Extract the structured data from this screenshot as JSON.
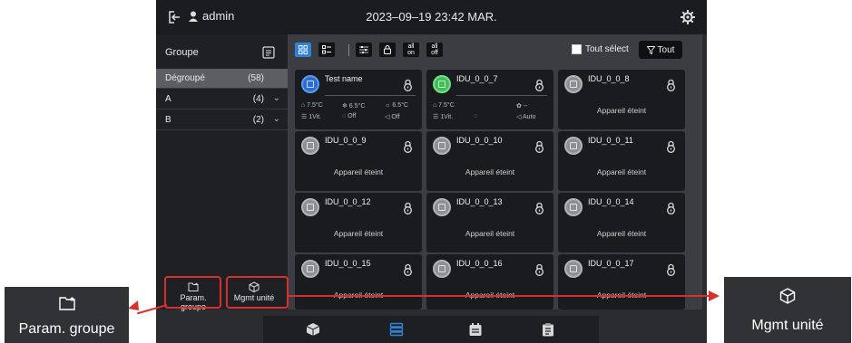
{
  "topbar": {
    "user": "admin",
    "datetime": "2023–09–19 23:42 MAR."
  },
  "sidebar": {
    "header": "Groupe",
    "groups": [
      {
        "name": "Dégroupé",
        "count": "(58)",
        "expandable": false,
        "selected": true
      },
      {
        "name": "A",
        "count": "(4)",
        "expandable": true,
        "selected": false
      },
      {
        "name": "B",
        "count": "(2)",
        "expandable": true,
        "selected": false
      }
    ],
    "param_groupe": "Param. groupe",
    "mgmt_unite": "Mgmt unité"
  },
  "toolbar": {
    "all_on": [
      "all",
      "on"
    ],
    "all_off": [
      "all",
      "off"
    ],
    "select_all": "Tout sélect",
    "filter_all": "Tout"
  },
  "cards": [
    {
      "name": "Test name",
      "color": "blue",
      "on": true,
      "row1": [
        "⌂ 7.5°C",
        "❄ 6.5°C",
        "☼ 6.5°C"
      ],
      "row2": [
        "☰ 1Vit.",
        "◌ Off",
        "◁ Off"
      ]
    },
    {
      "name": "IDU_0_0_7",
      "color": "green",
      "on": true,
      "row1": [
        "⌂ 7.5°C",
        "",
        "✿ --"
      ],
      "row2": [
        "☰ 1Vit.",
        "◌",
        "◁ Auto"
      ]
    },
    {
      "name": "IDU_0_0_8",
      "status": "Appareil éteint"
    },
    {
      "name": "IDU_0_0_9",
      "status": "Appareil éteint"
    },
    {
      "name": "IDU_0_0_10",
      "status": "Appareil éteint"
    },
    {
      "name": "IDU_0_0_11",
      "status": "Appareil éteint"
    },
    {
      "name": "IDU_0_0_12",
      "status": "Appareil éteint"
    },
    {
      "name": "IDU_0_0_13",
      "status": "Appareil éteint"
    },
    {
      "name": "IDU_0_0_14",
      "status": "Appareil éteint"
    },
    {
      "name": "IDU_0_0_15",
      "status": "Appareil éteint"
    },
    {
      "name": "IDU_0_0_16",
      "status": "Appareil éteint"
    },
    {
      "name": "IDU_0_0_17",
      "status": "Appareil éteint"
    }
  ],
  "callouts": {
    "left": "Param. groupe",
    "right": "Mgmt unité"
  },
  "colors": {
    "accent": "#2e82d8",
    "callout": "#d9302c"
  }
}
